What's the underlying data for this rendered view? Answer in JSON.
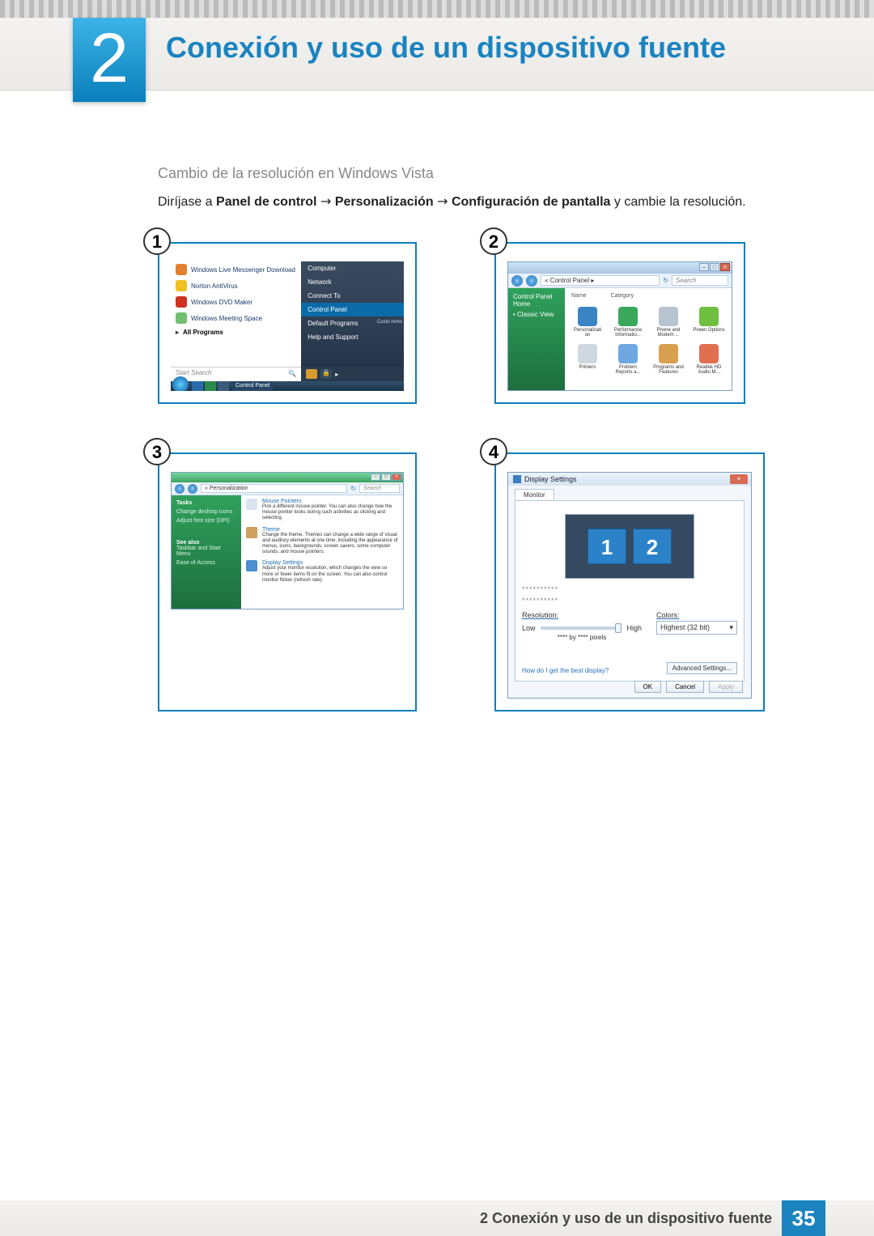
{
  "chapter": {
    "number": "2",
    "title": "Conexión y uso de un dispositivo fuente"
  },
  "section": {
    "subheading": "Cambio de la resolución en Windows Vista",
    "instruction_prefix": "Diríjase a ",
    "path1": "Panel de control",
    "path2": "Personalización",
    "path3": "Configuración de pantalla",
    "instruction_suffix": " y cambie la resolución.",
    "arrow": "→"
  },
  "step_numbers": [
    "1",
    "2",
    "3",
    "4"
  ],
  "screenshot1": {
    "left_items": [
      {
        "label": "Windows Live Messenger Download",
        "icon_bg": "#e08030"
      },
      {
        "label": "Norton AntiVirus",
        "icon_bg": "#f0c020"
      },
      {
        "label": "Windows DVD Maker",
        "icon_bg": "#d03020"
      },
      {
        "label": "Windows Meeting Space",
        "icon_bg": "#70c070"
      }
    ],
    "all_programs": "All Programs",
    "search_placeholder": "Start Search",
    "right_items": [
      "Computer",
      "Network",
      "Connect To",
      "Control Panel",
      "Default Programs",
      "Help and Support"
    ],
    "right_hl_index": 3,
    "right_extra": "Custo remo",
    "taskbar_label": "Control Panel"
  },
  "screenshot2": {
    "crumb": "« Control Panel ▸",
    "search_placeholder": "Search",
    "side_links": [
      "Control Panel Home",
      "Classic View"
    ],
    "headers": [
      "Name",
      "Category"
    ],
    "row1": [
      {
        "label": "Personalizati on",
        "bg": "#3a84c4"
      },
      {
        "label": "Performance Informatio...",
        "bg": "#3aa85c"
      },
      {
        "label": "Phone and Modem ...",
        "bg": "#b8c4d0"
      },
      {
        "label": "Power Options",
        "bg": "#6fbf3f"
      }
    ],
    "row2": [
      {
        "label": "Printers",
        "bg": "#cfd8e0"
      },
      {
        "label": "Problem Reports a...",
        "bg": "#6fa8e0"
      },
      {
        "label": "Programs and Features",
        "bg": "#d8a050"
      },
      {
        "label": "Realtek HD Audio M...",
        "bg": "#e07050"
      }
    ]
  },
  "screenshot3": {
    "crumb": "« Personalization",
    "search_placeholder": "Search",
    "side": {
      "tasks_hd": "Tasks",
      "task_links": [
        "Change desktop icons",
        "Adjust font size (DPI)"
      ],
      "seealso_hd": "See also",
      "seealso_links": [
        "Taskbar and Start Menu",
        "Ease of Access"
      ]
    },
    "entries": [
      {
        "title": "Mouse Pointers",
        "desc": "Pick a different mouse pointer. You can also change how the mouse pointer looks during such activities as clicking and selecting.",
        "bg": "#d8e4f0"
      },
      {
        "title": "Theme",
        "desc": "Change the theme. Themes can change a wide range of visual and auditory elements at one time, including the appearance of menus, icons, backgrounds, screen savers, some computer sounds, and mouse pointers.",
        "bg": "#d0a060"
      },
      {
        "title": "Display Settings",
        "desc": "Adjust your monitor resolution, which changes the view so more or fewer items fit on the screen. You can also control monitor flicker (refresh rate).",
        "bg": "#4a8fd0"
      }
    ]
  },
  "screenshot4": {
    "title": "Display Settings",
    "tab": "Monitor",
    "mon1": "1",
    "mon2": "2",
    "stars": "**********",
    "res_label": "Resolution:",
    "low": "Low",
    "high": "High",
    "px_label": "**** by **** pixels",
    "col_label": "Colors:",
    "col_value": "Highest (32 bit)",
    "link": "How do I get the best display?",
    "adv": "Advanced Settings...",
    "ok": "OK",
    "cancel": "Cancel",
    "apply": "Apply"
  },
  "footer": {
    "label": "2 Conexión y uso de un dispositivo fuente",
    "page": "35"
  }
}
